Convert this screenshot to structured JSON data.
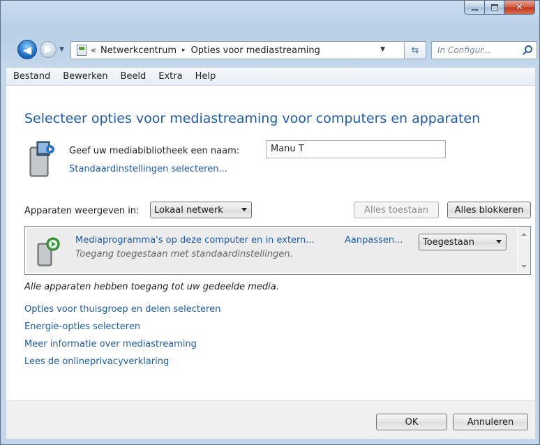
{
  "address": {
    "chevron": "«",
    "segments": [
      "Netwerkcentrum",
      "Opties voor mediastreaming"
    ],
    "separator": "▸"
  },
  "search": {
    "placeholder": "In Configur..."
  },
  "menu": [
    "Bestand",
    "Bewerken",
    "Beeld",
    "Extra",
    "Help"
  ],
  "heading": "Selecteer opties voor mediastreaming voor computers en apparaten",
  "library": {
    "label": "Geef uw mediabibliotheek een naam:",
    "value": "Manu T",
    "defaults_link": "Standaardinstellingen selecteren..."
  },
  "devices": {
    "show_label": "Apparaten weergeven in:",
    "filter_value": "Lokaal netwerk",
    "allow_all": "Alles toestaan",
    "block_all": "Alles blokkeren",
    "items": [
      {
        "title": "Mediaprogramma's op deze computer en in extern...",
        "subtitle": "Toegang toegestaan met standaardinstellingen.",
        "customize": "Aanpassen...",
        "status": "Toegestaan"
      }
    ],
    "note": "Alle apparaten hebben toegang tot uw gedeelde media."
  },
  "links": [
    "Opties voor thuisgroep en delen selecteren",
    "Energie-opties selecteren",
    "Meer informatie over mediastreaming",
    "Lees de onlineprivacyverklaring"
  ],
  "footer": {
    "ok": "OK",
    "cancel": "Annuleren"
  }
}
